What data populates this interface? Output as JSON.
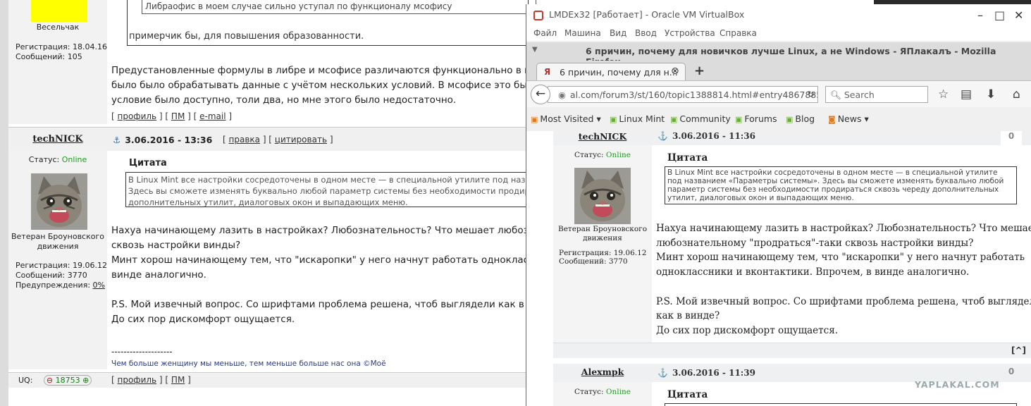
{
  "background_post": {
    "user1_name": "Весельчак",
    "user1_reg": "Регистрация: 18.04.16",
    "user1_posts": "Сообщений: 105",
    "quote1_text": "Либраофис в моем случае сильно уступал по функционалу мсофису",
    "quote1_tail": "примерчик бы, для повышения образованности.",
    "text1_lines": [
      "Предустановленные формулы в либре и мсофисе различаются функционально в пол",
      "было было обрабатывать данные с учётом нескольких условий. В мсофисе это было",
      "условие было доступно, толи два, но мне этого было недостаточно."
    ],
    "links1": {
      "profile": "профиль",
      "pm": "ПМ",
      "email": "e-mail"
    },
    "author": "techNICK",
    "date": "3.06.2016 - 13:36",
    "edit": "правка",
    "cite": "цитировать",
    "status_label": "Статус:",
    "status_value": "Online",
    "rank": [
      "Ветеран Броуновского",
      "движения"
    ],
    "reg": "Регистрация: 19.06.12",
    "posts": "Сообщений: 3770",
    "warn_label": "Предупреждения:",
    "warn_value": "0%",
    "quote_label": "Цитата",
    "quote_lines": [
      "В Linux Mint все настройки сосредоточены в одном месте — в специальной утилите под назван",
      "Здесь вы сможете изменять буквально любой параметр системы без необходимости продират",
      "дополнительных утилит, диалоговых окон и выпадающих меню."
    ],
    "text2_lines": [
      "Нахуа начинающему лазить в настройках? Любознательность? Что мешает любознат",
      "сквозь настройки винды?",
      "Минт хорош начинающему тем, что \"искаропки\" у него начнут работать однокласснин",
      "винде аналогично."
    ],
    "text3_lines": [
      "P.S. Мой извечный вопрос. Со шрифтами проблема решена, чтоб выглядели как в вин",
      "До сих пор дискомфорт ощущается."
    ],
    "sig_line": "--------------------",
    "signature": "Чем больше женщину мы меньше, тем меньше больше нас она ©Моё",
    "uq_label": "UQ:",
    "uq_value": "18753",
    "links2": {
      "profile": "профиль",
      "pm": "ПМ"
    }
  },
  "vbox": {
    "title": "LMDEx32 [Работает] - Oracle VM VirtualBox",
    "menu": [
      "Файл",
      "Машина",
      "Вид",
      "Ввод",
      "Устройства",
      "Справка"
    ],
    "controls": {
      "minimize": "–",
      "restore": "□",
      "close": "✕"
    }
  },
  "firefox": {
    "window_title": "6 причин, почему для новичков лучше Linux, а не Windows - ЯПлакалъ - Mozilla Firefox",
    "tab_title": "6 причин, почему для н...",
    "url": "al.com/forum3/st/160/topic1388814.html#entry48678853",
    "search_placeholder": "Search",
    "bookmarks": [
      "Most Visited",
      "Linux Mint",
      "Community",
      "Forums",
      "Blog",
      "News"
    ]
  },
  "guest_page": {
    "author": "techNICK",
    "date": "3.06.2016 - 11:36",
    "score": "0",
    "status_label": "Статус:",
    "status_value": "Online",
    "rank": [
      "Ветеран Броуновского",
      "движения"
    ],
    "reg": "Регистрация: 19.06.12",
    "posts": "Сообщений: 3770",
    "quote_label": "Цитата",
    "quote_text": "В Linux Mint все настройки сосредоточены в одном месте — в специальной утилите под названием «Параметры системы». Здесь вы сможете изменять буквально любой параметр системы без необходимости продираться сквозь череду дополнительных утилит, диалоговых окон и выпадающих меню.",
    "text_lines": [
      "Нахуа начинающему лазить в настройках? Любознательность? Что мешает",
      "любознательному \"продраться\"-таки сквозь настройки винды?",
      "Минт хорош начинающему тем, что \"искаропки\" у него начнут работать",
      "одноклассники и вконтактики. Впрочем, в винде аналогично.",
      "",
      "P.S. Мой извечный вопрос. Со шрифтами проблема решена, чтоб выглядели",
      "как в винде?",
      "До сих пор дискомфорт ощущается."
    ],
    "up_button": "[^]",
    "post2_author": "Alexmpk",
    "post2_date": "3.06.2016 - 11:39",
    "post2_score": "0",
    "post2_status_label": "Статус:",
    "post2_status_value": "Online",
    "post2_quote_label": "Цитата"
  },
  "watermark": "YAPLAKAL.COM"
}
